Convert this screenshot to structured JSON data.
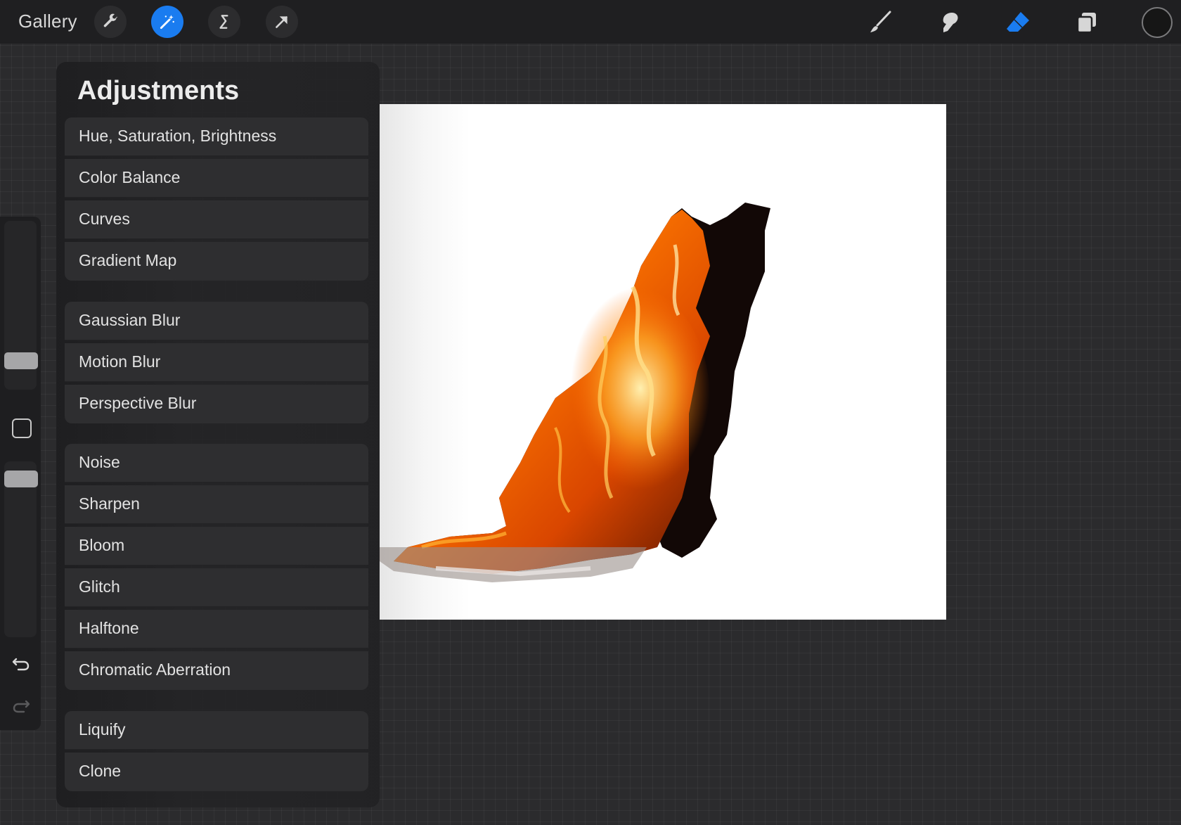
{
  "topbar": {
    "gallery_label": "Gallery",
    "left_tools": [
      {
        "icon": "wrench-icon",
        "active": false
      },
      {
        "icon": "magic-wand-icon",
        "active": true
      },
      {
        "icon": "selection-icon",
        "active": false
      },
      {
        "icon": "transform-arrow-icon",
        "active": false
      }
    ],
    "right_tools": [
      "brush-icon",
      "smudge-icon",
      "eraser-icon",
      "layers-icon"
    ],
    "active_color": "#161616",
    "accent_color": "#1a7cf0"
  },
  "adjustments": {
    "title": "Adjustments",
    "groups": [
      [
        "Hue, Saturation, Brightness",
        "Color Balance",
        "Curves",
        "Gradient Map"
      ],
      [
        "Gaussian Blur",
        "Motion Blur",
        "Perspective Blur"
      ],
      [
        "Noise",
        "Sharpen",
        "Bloom",
        "Glitch",
        "Halftone",
        "Chromatic Aberration"
      ],
      [
        "Liquify",
        "Clone"
      ]
    ]
  }
}
